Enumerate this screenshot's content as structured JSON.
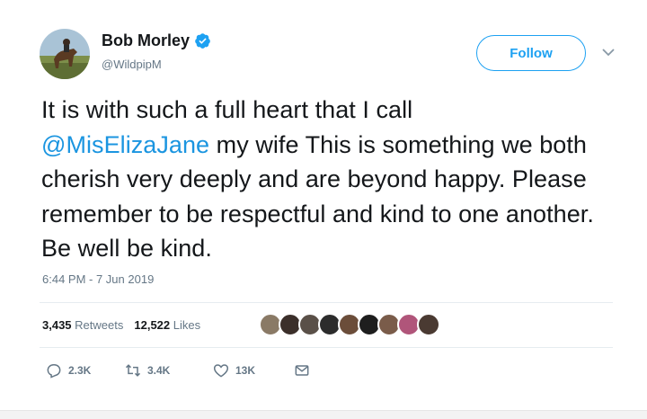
{
  "author": {
    "name": "Bob Morley",
    "handle": "@WildpipM",
    "verified": true,
    "avatar_icon": "avatar-horse-rider-photo"
  },
  "follow_button": {
    "label": "Follow"
  },
  "menu": {
    "icon": "chevron-down-icon"
  },
  "tweet": {
    "text_before_mention": "It is with such a full heart that I call",
    "mention": "@MisElizaJane",
    "text_after_mention": " my wife This is something we both cherish very deeply and are beyond happy. Please remember to be respectful and kind to one another. Be well be kind.",
    "timestamp": "6:44 PM - 7 Jun 2019"
  },
  "stats": {
    "retweets_count": "3,435",
    "retweets_label": "Retweets",
    "likes_count": "12,522",
    "likes_label": "Likes"
  },
  "likers": [
    "#8a7a66",
    "#3b2f2a",
    "#5a5048",
    "#2c2c2c",
    "#6b4d3a",
    "#1e1e1e",
    "#7a5c4a",
    "#b0557a",
    "#4a3a32"
  ],
  "actions": {
    "replies": "2.3K",
    "retweets": "3.4K",
    "likes": "13K"
  },
  "colors": {
    "accent": "#1da1f2",
    "mention": "#1b95e0",
    "muted": "#657786",
    "text": "#14171a"
  }
}
